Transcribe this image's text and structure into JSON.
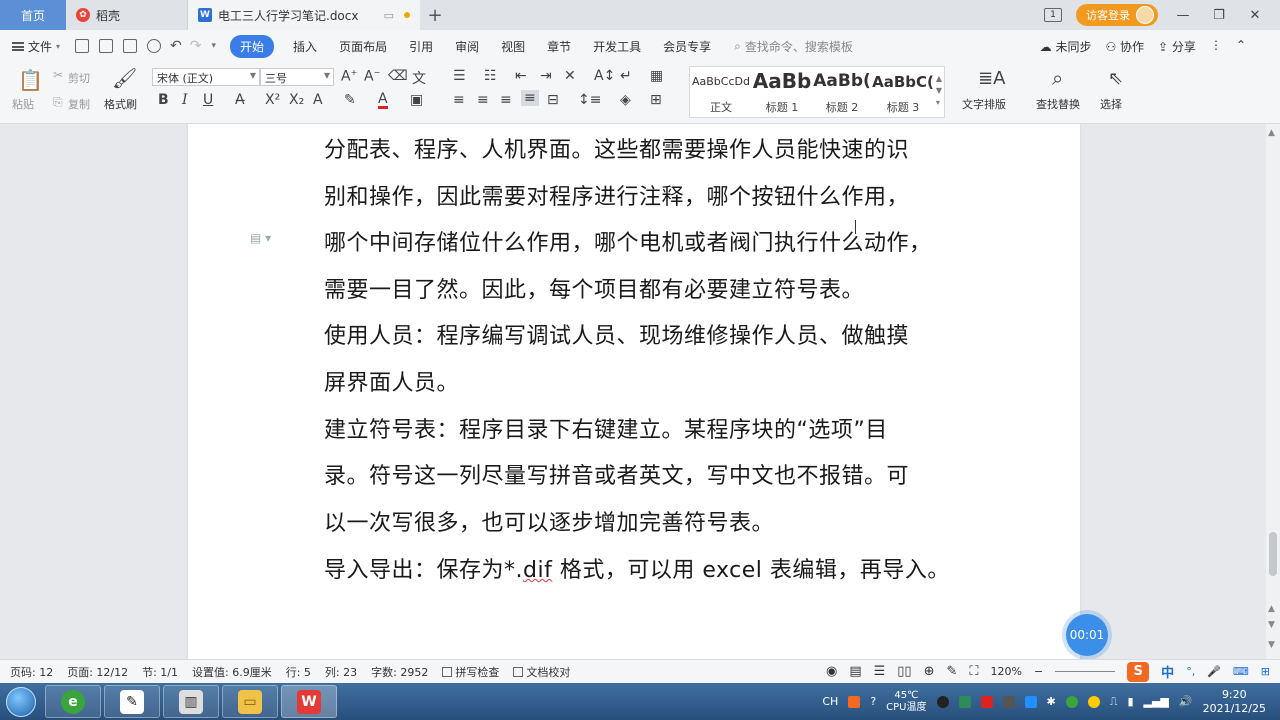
{
  "titlebar": {
    "tab_home": "首页",
    "tab_daoke": "稻壳",
    "tab_doc": "电工三人行学习笔记.docx",
    "login": "访客登录",
    "win_num": "1"
  },
  "menubar": {
    "file": "文件",
    "items": [
      "开始",
      "插入",
      "页面布局",
      "引用",
      "审阅",
      "视图",
      "章节",
      "开发工具",
      "会员专享"
    ],
    "search": "查找命令、搜索模板",
    "right": [
      "未同步",
      "协作",
      "分享"
    ]
  },
  "ribbon": {
    "paste": "粘贴",
    "cut": "剪切",
    "copy": "复制",
    "format_painter": "格式刷",
    "font_name": "宋体 (正文)",
    "font_size": "三号",
    "styles": [
      {
        "sample": "AaBbCcDd",
        "label": "正文"
      },
      {
        "sample": "AaBb",
        "label": "标题 1"
      },
      {
        "sample": "AaBb(",
        "label": "标题 2"
      },
      {
        "sample": "AaBbC(",
        "label": "标题 3"
      }
    ],
    "text_layout": "文字排版",
    "find_replace": "查找替换",
    "select": "选择"
  },
  "document": {
    "lines": [
      "分配表、程序、人机界面。这些都需要操作人员能快速的识",
      "别和操作，因此需要对程序进行注释，哪个按钮什么作用，",
      "哪个中间存储位什么作用，哪个电机或者阀门执行什么动作，",
      "需要一目了然。因此，每个项目都有必要建立符号表。",
      "使用人员：程序编写调试人员、现场维修操作人员、做触摸",
      "屏界面人员。",
      "建立符号表：程序目录下右键建立。某程序块的“选项”目",
      "录。符号这一列尽量写拼音或者英文，写中文也不报错。可",
      "以一次写很多，也可以逐步增加完善符号表。"
    ],
    "last_line": {
      "before": "导入导出：保存为*.",
      "squiggle": "dif",
      "after": " 格式，可以用 excel 表编辑，再导入。"
    },
    "timer": "00:01"
  },
  "statusbar": {
    "page_num": "页码: 12",
    "pages": "页面: 12/12",
    "section": "节: 1/1",
    "setting": "设置值: 6.9厘米",
    "row": "行: 5",
    "col": "列: 23",
    "words": "字数: 2952",
    "spellcheck": "拼写检查",
    "doc_proof": "文档校对",
    "zoom": "120%",
    "ime": "S",
    "ime_lang": "中"
  },
  "taskbar": {
    "tray_ch": "CH",
    "cpu_temp": "45℃",
    "cpu_label": "CPU温度",
    "time": "9:20",
    "date": "2021/12/25"
  },
  "colors": {
    "accent": "#3a7de8",
    "home_tab": "#5b8fd6",
    "login": "#f29a1f",
    "timer": "#3b8fe8",
    "ime": "#f26a21",
    "squiggle": "#e53935"
  }
}
